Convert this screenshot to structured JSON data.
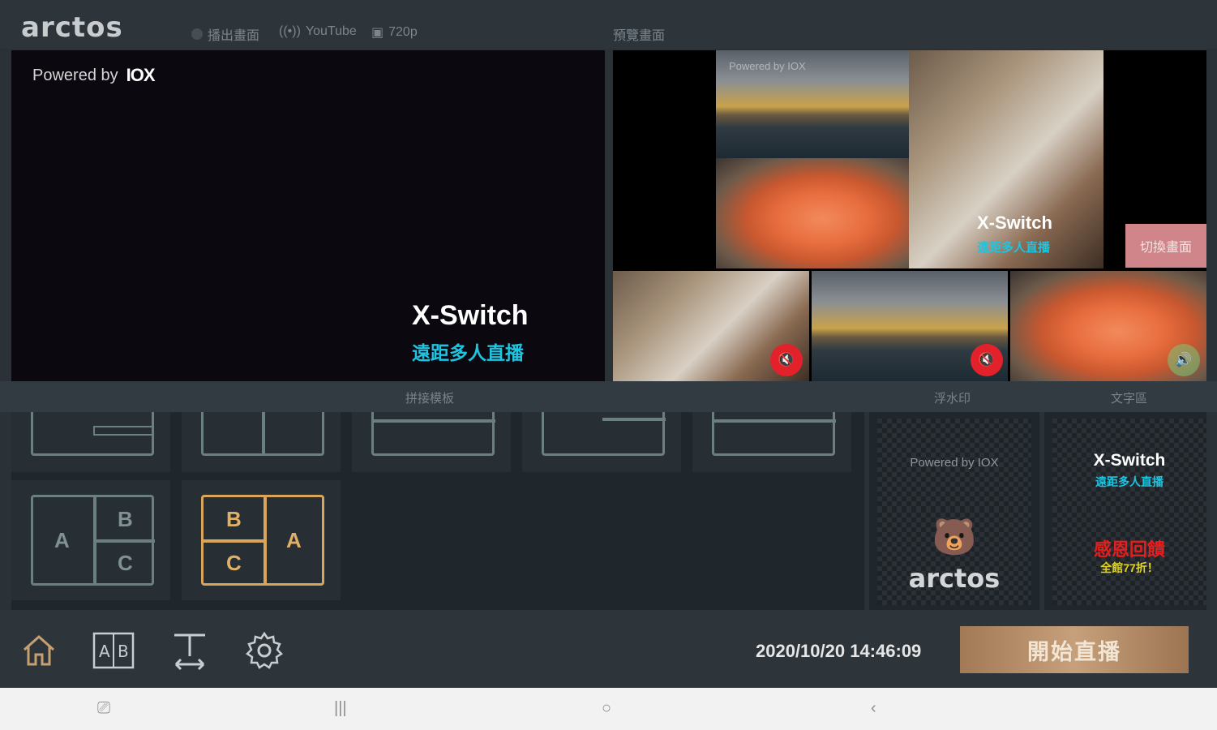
{
  "app": {
    "logo": "arctos"
  },
  "topbar": {
    "output_label": "播出畫面",
    "platform": "YouTube",
    "resolution": "720p",
    "preview_label": "預覽畫面"
  },
  "output": {
    "powered_by": "Powered by",
    "brand": "IOX",
    "title": "X-Switch",
    "subtitle": "遠距多人直播"
  },
  "preview": {
    "powered_by": "Powered by IOX",
    "title": "X-Switch",
    "subtitle": "遠距多人直播",
    "switch_button": "切換畫面"
  },
  "sources": [
    {
      "id": "chef",
      "audio": "muted"
    },
    {
      "id": "sunset",
      "audio": "muted"
    },
    {
      "id": "salmon",
      "audio": "on"
    }
  ],
  "sections": {
    "templates": "拼接模板",
    "watermark": "浮水印",
    "text": "文字區"
  },
  "templates": {
    "letters": [
      "A",
      "B",
      "C"
    ]
  },
  "watermarks": {
    "item1_text": "Powered by IOX",
    "item2_text": "arctos"
  },
  "text_items": {
    "item1_title": "X-Switch",
    "item1_sub": "遠距多人直播",
    "item2_title": "感恩回饋",
    "item2_sub": "全館77折！"
  },
  "toolbar": {
    "datetime": "2020/10/20 14:46:09",
    "live_button": "開始直播"
  },
  "colors": {
    "accent_gold": "#d8a55a",
    "cyan": "#1fc4e0",
    "mute_red": "#e3212b",
    "switch_pink": "#cf8589"
  }
}
